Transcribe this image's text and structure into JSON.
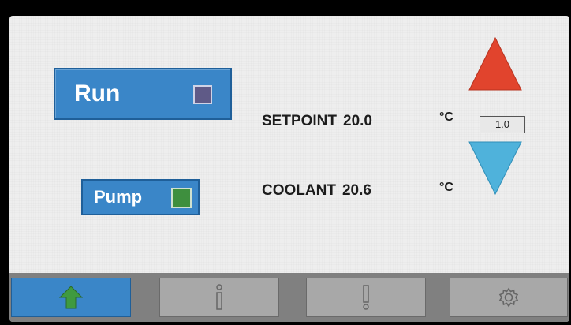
{
  "controls": {
    "run_label": "Run",
    "pump_label": "Pump"
  },
  "readouts": {
    "setpoint_label": "SETPOINT",
    "setpoint_value": "20.0",
    "coolant_label": "COOLANT",
    "coolant_value": "20.6",
    "unit": "°C"
  },
  "step_value": "1.0",
  "colors": {
    "button_blue": "#3a86c8",
    "run_indicator": "#5f5a87",
    "pump_indicator": "#3e8f3e",
    "up_arrow": "#e1442d",
    "down_arrow": "#4fb2db",
    "home_arrow": "#3f9a3f",
    "navbar": "#808080"
  },
  "navbar": {
    "items": [
      "home-icon",
      "info-icon",
      "alarm-icon",
      "gear-icon"
    ],
    "active": "home-icon"
  }
}
